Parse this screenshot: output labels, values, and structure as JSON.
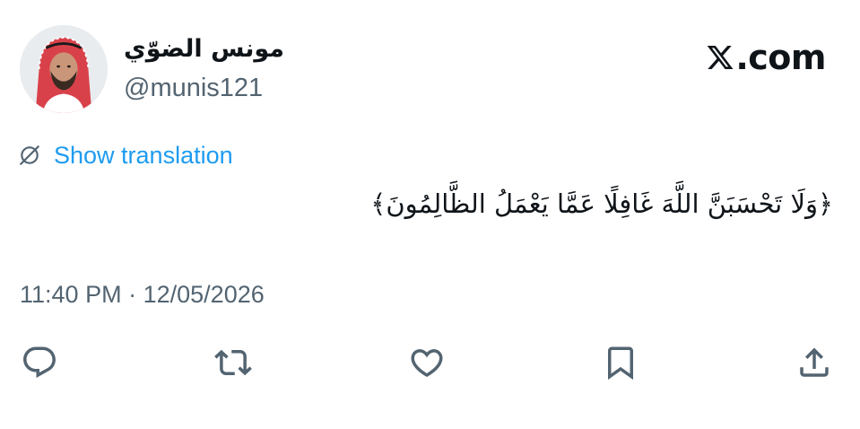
{
  "author": {
    "display_name": "مونس الضوّي",
    "handle": "@munis121",
    "avatar_icon": "user-avatar"
  },
  "brand": {
    "icon": "x-logo-icon",
    "text": ".com"
  },
  "translation": {
    "icon": "globe-slash-icon",
    "label": "Show translation"
  },
  "tweet": {
    "text": "﴿وَلَا تَحْسَبَنَّ اللَّهَ غَافِلًا عَمَّا يَعْمَلُ الظَّالِمُونَ﴾"
  },
  "meta": {
    "time": "11:40 PM",
    "separator": "·",
    "date": "12/05/2026"
  },
  "actions": [
    {
      "icon": "reply-icon"
    },
    {
      "icon": "repost-icon"
    },
    {
      "icon": "like-icon"
    },
    {
      "icon": "bookmark-icon"
    },
    {
      "icon": "share-icon"
    }
  ],
  "colors": {
    "text": "#0f1419",
    "secondary": "#536471",
    "accent": "#1d9bf0",
    "icon": "#536471"
  }
}
